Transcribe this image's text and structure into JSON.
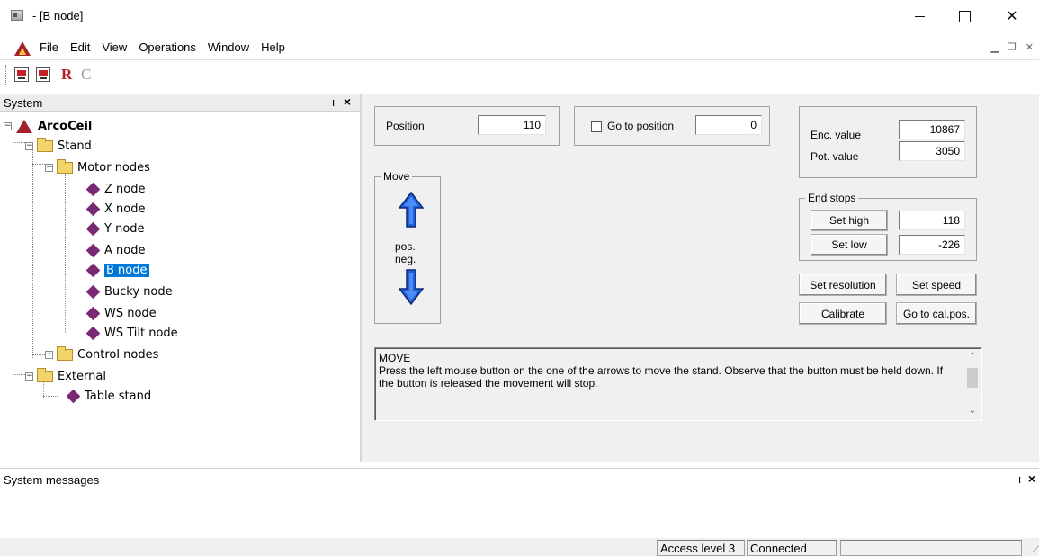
{
  "window": {
    "title": " - [B node]"
  },
  "menu": {
    "items": [
      "File",
      "Edit",
      "View",
      "Operations",
      "Window",
      "Help"
    ]
  },
  "toolbar": {
    "r_label": "R",
    "c_label": "C"
  },
  "system_pane": {
    "title": "System",
    "tree": {
      "root": "ArcoCeil",
      "stand": "Stand",
      "motor_nodes": "Motor nodes",
      "nodes": [
        "Z node",
        "X node",
        "Y node",
        "A node",
        "B node",
        "Bucky node",
        "WS node",
        "WS Tilt node"
      ],
      "control_nodes": "Control nodes",
      "external": "External",
      "table_stand": "Table stand"
    }
  },
  "panel": {
    "position_label": "Position",
    "position_value": "110",
    "goto_label": "Go to position",
    "goto_value": "0",
    "move_legend": "Move",
    "pos_label": "pos.",
    "neg_label": "neg.",
    "enc_label": "Enc. value",
    "enc_value": "10867",
    "pot_label": "Pot. value",
    "pot_value": "3050",
    "endstops_legend": "End stops",
    "set_high": "Set high",
    "high_value": "118",
    "set_low": "Set low",
    "low_value": "-226",
    "set_resolution": "Set resolution",
    "set_speed": "Set speed",
    "calibrate": "Calibrate",
    "goto_cal": "Go to cal.pos.",
    "message_title": "MOVE",
    "message_body": "Press the left mouse button on the one of the arrows to move the stand. Observe that the button must be held down. If the button is released the movement will stop."
  },
  "system_messages": {
    "title": "System messages"
  },
  "status": {
    "access": "Access level 3",
    "connection": "Connected",
    "extra": ""
  },
  "colors": {
    "selection": "#0078d7",
    "arrow": "#1f5fd8",
    "logo": "#a3222d",
    "node": "#7a2a73"
  }
}
